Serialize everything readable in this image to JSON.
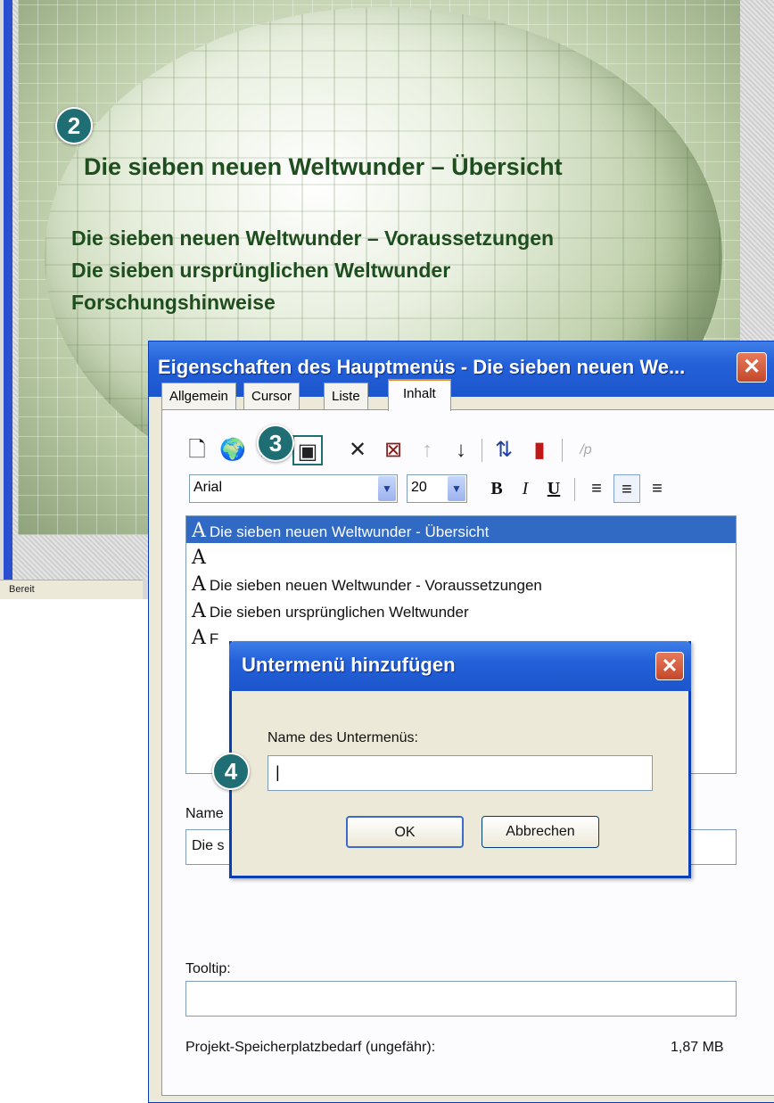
{
  "slide": {
    "title": "Die sieben neuen Weltwunder – Übersicht",
    "lines": [
      "Die sieben neuen Weltwunder – Voraussetzungen",
      "Die sieben ursprünglichen Weltwunder",
      "Forschungshinweise"
    ]
  },
  "status_bar": {
    "text": "Bereit"
  },
  "badges": [
    "2",
    "3",
    "4"
  ],
  "properties_dialog": {
    "title": "Eigenschaften des Hauptmenüs - Die sieben neuen We...",
    "close_icon": "✕",
    "tabs": [
      "Allgemein",
      "Cursor",
      "Liste",
      "Inhalt"
    ],
    "active_tab": "Inhalt",
    "toolbar": {
      "icons": [
        "new-item-icon",
        "add-link-icon",
        "add-text-icon",
        "add-submenu-icon",
        "delete-icon",
        "delete-all-icon",
        "move-up-icon",
        "move-down-icon",
        "sort-icon",
        "color-icon",
        "paragraph-icon"
      ],
      "glyphs": [
        "🗋",
        "🌍",
        "A",
        "▣",
        "✕",
        "⊠",
        "↑",
        "↓",
        "⇅",
        "▮",
        "/p"
      ]
    },
    "font": {
      "family": "Arial",
      "size": "20"
    },
    "format_glyphs": {
      "bold": "B",
      "italic": "I",
      "underline": "U",
      "align_left": "≡",
      "align_center": "≡",
      "align_right": "≡"
    },
    "list_glyph": "A",
    "list_items": [
      "Die sieben neuen Weltwunder - Übersicht",
      "",
      "Die sieben neuen Weltwunder - Voraussetzungen",
      "Die sieben ursprünglichen Weltwunder",
      "F"
    ],
    "name_label": "Name",
    "name_value": "Die s",
    "tooltip_label": "Tooltip:",
    "tooltip_value": "",
    "memory_label": "Projekt-Speicherplatzbedarf (ungefähr):",
    "memory_value": "1,87 MB"
  },
  "submenu_dialog": {
    "title": "Untermenü hinzufügen",
    "close_icon": "✕",
    "field_label": "Name des Untermenüs:",
    "field_value": "|",
    "ok_label": "OK",
    "cancel_label": "Abbrechen"
  },
  "colors": {
    "title_bar": "#2461d9",
    "badge": "#1f6e74",
    "selection": "#316ac5",
    "slide_text": "#1e4d1e",
    "close_button": "#c4482b"
  }
}
